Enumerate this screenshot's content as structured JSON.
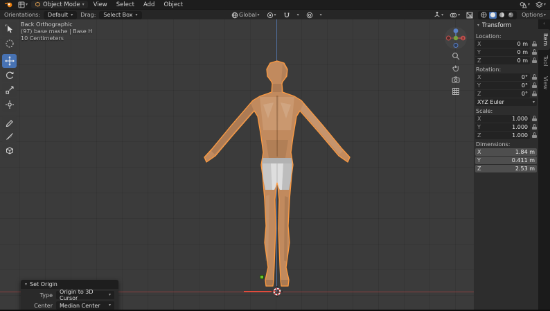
{
  "colors": {
    "accent_blue": "#4772b3",
    "selection_orange": "#ff9b40",
    "axis_x_red": "#8e4040",
    "axis_z_blue": "#52709f",
    "skin_tone": "#c18a5e"
  },
  "icons": {
    "chevron_down": "▾",
    "chevron_left": "‹",
    "collapse_open": "▾"
  },
  "topbar": {
    "mode": "Object Mode",
    "menus": [
      "View",
      "Select",
      "Add",
      "Object"
    ]
  },
  "toolrow": {
    "orientations_label": "Orientations:",
    "orientations_value": "Default",
    "drag_label": "Drag:",
    "drag_value": "Select Box",
    "orientation_value": "Global",
    "options_label": "Options"
  },
  "viewport_overlay": {
    "line1": "Back Orthographic",
    "line2": "(97) base mashe | Base H",
    "line3": "10 Centimeters"
  },
  "gizmo": {
    "x_label": "X"
  },
  "axes": [
    "X",
    "Y",
    "Z"
  ],
  "transform": {
    "title": "Transform",
    "location_label": "Location:",
    "location": {
      "x": "0 m",
      "y": "0 m",
      "z": "0 m"
    },
    "rotation_label": "Rotation:",
    "rotation": {
      "x": "0°",
      "y": "0°",
      "z": "0°"
    },
    "euler_mode": "XYZ Euler",
    "scale_label": "Scale:",
    "scale": {
      "x": "1.000",
      "y": "1.000",
      "z": "1.000"
    },
    "dimensions_label": "Dimensions:",
    "dimensions": {
      "x": "1.84 m",
      "y": "0.411 m",
      "z": "2.53 m"
    }
  },
  "side_tabs": [
    "Item",
    "Tool",
    "View"
  ],
  "set_origin": {
    "title": "Set Origin",
    "type_label": "Type",
    "type_value": "Origin to 3D Cursor",
    "center_label": "Center",
    "center_value": "Median Center"
  }
}
